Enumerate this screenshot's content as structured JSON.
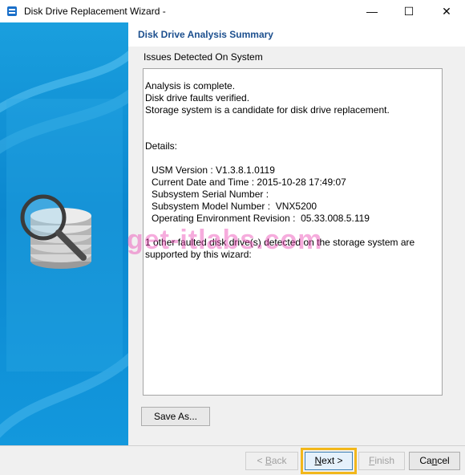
{
  "window": {
    "title": "Disk Drive Replacement Wizard -",
    "minimize_glyph": "—",
    "maximize_glyph": "☐",
    "close_glyph": "✕"
  },
  "header": {
    "title": "Disk Drive Analysis Summary"
  },
  "section": {
    "label": "Issues Detected On System"
  },
  "details_box": {
    "lines": [
      "Analysis is complete.",
      "Disk drive faults verified.",
      "Storage system is a candidate for disk drive replacement.",
      "Details:",
      "USM Version : V1.3.8.1.0119",
      "Current Date and Time : 2015-10-28 17:49:07",
      "Subsystem Serial Number :",
      "Subsystem Model Number :  VNX5200",
      "Operating Environment Revision :  05.33.008.5.119",
      "1 other faulted disk drive(s) detected on the storage system are",
      "supported by this wizard:"
    ]
  },
  "buttons": {
    "save_as": "Save As...",
    "back_prefix": "< ",
    "back_key": "B",
    "back_rest": "ack",
    "next_key": "N",
    "next_rest": "ext >",
    "finish_key": "F",
    "finish_rest": "inish",
    "cancel_prefix": "Ca",
    "cancel_key": "n",
    "cancel_rest": "cel"
  },
  "watermark": "get-itlabs.com",
  "colors": {
    "left_panel": "#0b87cf",
    "header_text": "#1c4f8e",
    "highlight": "#f2b71a"
  },
  "icons": {
    "app": "disk-wizard-icon",
    "art": "disk-stack-magnifier-icon"
  }
}
